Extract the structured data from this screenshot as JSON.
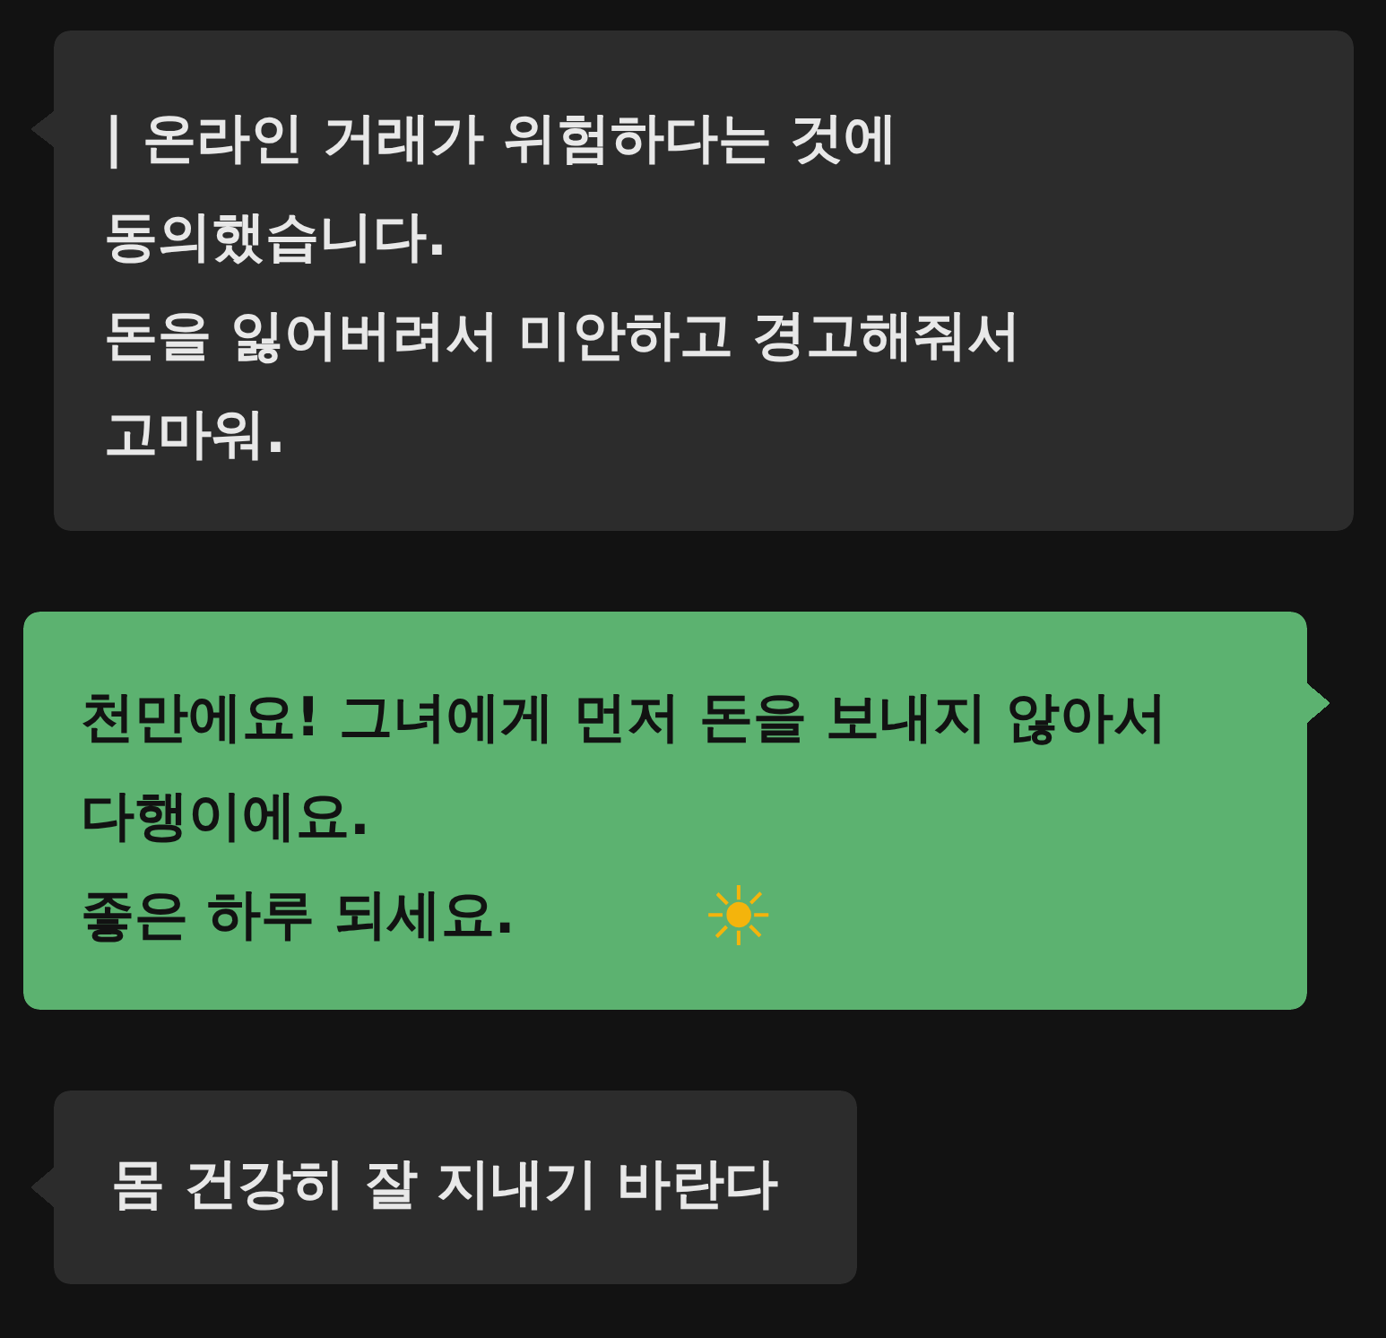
{
  "messages": [
    {
      "kind": "received",
      "lines": [
        "| 온라인 거래가 위험하다는 것에",
        "동의했습니다.",
        "돈을 잃어버려서 미안하고 경고해줘서",
        "고마워."
      ]
    },
    {
      "kind": "sent",
      "lines": [
        "천만에요! 그녀에게 먼저 돈을 보내지 않아서",
        "다행이에요.",
        "좋은 하루 되세요."
      ],
      "emoji": "☀"
    },
    {
      "kind": "received",
      "lines": [
        "몸 건강히 잘 지내기 바란다"
      ]
    }
  ]
}
